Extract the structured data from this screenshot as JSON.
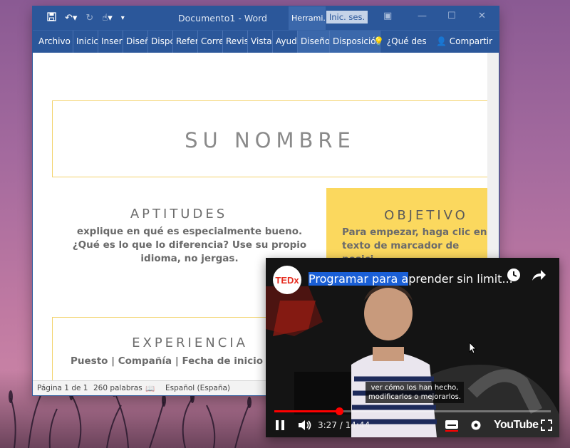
{
  "word": {
    "title": "Documento1  -  Word",
    "context_tab": "Herrami...",
    "sign_in": "Inic. ses.",
    "ribbon_tabs": [
      "Archivo",
      "Inicic",
      "Inserti",
      "Diseñ",
      "Dispc",
      "Refer",
      "Corre",
      "Revis",
      "Vista",
      "Ayud",
      "Diseño",
      "Disposición"
    ],
    "tell_me": "¿Qué des",
    "share": "Compartir",
    "document": {
      "name": "SU NOMBRE",
      "skills_title": "APTITUDES",
      "skills_text": "explique en qué es especialmente bueno. ¿Qué es lo que lo diferencia? Use su propio idioma, no jergas.",
      "objective_title": "OBJETIVO",
      "objective_text": "Para empezar, haga clic en texto de marcador de posici",
      "experience_title": "EXPERIENCIA",
      "experience_text": "Puesto | Compañía | Fecha de inicio – F"
    },
    "status": {
      "page": "Página 1 de 1",
      "words": "260 palabras",
      "language": "Español (España)"
    },
    "colors": {
      "brand": "#2b579a",
      "accent_yellow": "#fbd85e"
    }
  },
  "video": {
    "channel_logo": "TEDx",
    "title_highlight": "Programar para a",
    "title_rest": "prender sin limit...",
    "subtitle_line1": "ver cómo los han hecho,",
    "subtitle_line2": "modificarlos o mejorarlos.",
    "time": "3:27 / 14:44",
    "progress_fraction": 0.235,
    "brand": "YouTube"
  }
}
